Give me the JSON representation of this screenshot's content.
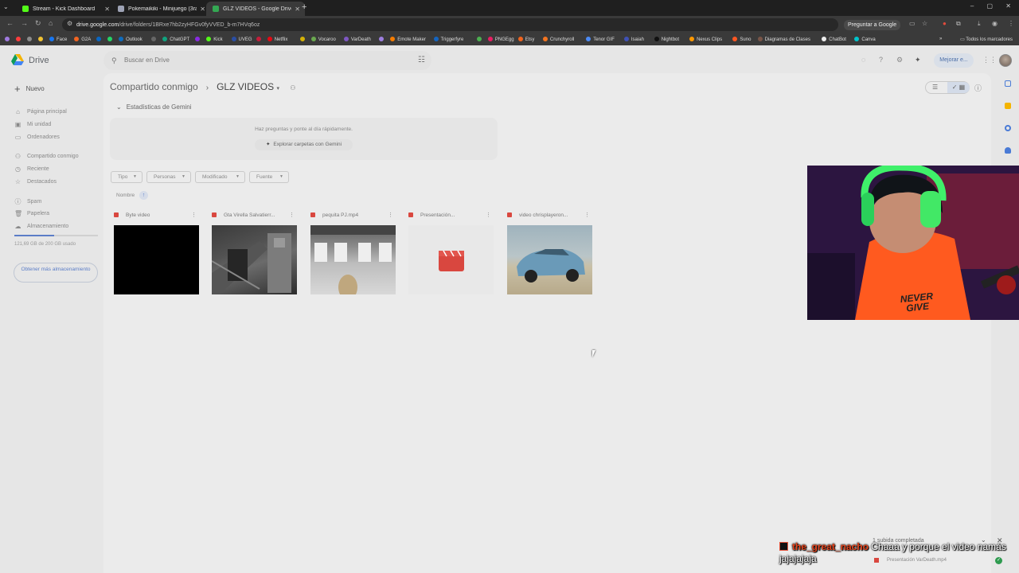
{
  "browser": {
    "tabs": [
      {
        "title": "Stream - Kick Dashboard",
        "favicon_color": "#53fc18",
        "active": false
      },
      {
        "title": "Pokemaikiki - Minijuego (3ra G",
        "favicon_color": "#9ea3b5",
        "active": false
      },
      {
        "title": "GLZ VIDEOS - Google Drive",
        "favicon_color": "#34a853",
        "active": true
      }
    ],
    "url_domain": "drive.google.com",
    "url_path": "/drive/folders/1BRxe7hb2zyHFGv0fyVVED_b-m7HVq6oz",
    "ask_google_label": "Preguntar a Google",
    "bookmarks": [
      {
        "label": "",
        "color": "#a07adf"
      },
      {
        "label": "",
        "color": "#ff3d3d"
      },
      {
        "label": "",
        "color": "#8c8c8c"
      },
      {
        "label": "",
        "color": "#f1c232"
      },
      {
        "label": "Face",
        "color": "#1877f2"
      },
      {
        "label": "G2A",
        "color": "#f26522"
      },
      {
        "label": "",
        "color": "#0a66c2"
      },
      {
        "label": "",
        "color": "#25d366"
      },
      {
        "label": "Outlook",
        "color": "#0f6cbd"
      },
      {
        "label": "",
        "color": "#666666"
      },
      {
        "label": "ChatGPT",
        "color": "#10a37f"
      },
      {
        "label": "",
        "color": "#8a2be2"
      },
      {
        "label": "Kick",
        "color": "#53fc18"
      },
      {
        "label": "UVEG",
        "color": "#2a4ea3"
      },
      {
        "label": "",
        "color": "#c41e3a"
      },
      {
        "label": "Netflix",
        "color": "#e50914"
      },
      {
        "label": "",
        "color": "#d4b106"
      },
      {
        "label": "Vocaroo",
        "color": "#6aa84f"
      },
      {
        "label": "VarDeath",
        "color": "#7e57c2"
      },
      {
        "label": "",
        "color": "#9d7fe0"
      },
      {
        "label": "Emote Maker",
        "color": "#f57c00"
      },
      {
        "label": "Triggerfyre",
        "color": "#1565c0"
      },
      {
        "label": "",
        "color": "#4caf50"
      },
      {
        "label": "PNGEgg",
        "color": "#e91e63"
      },
      {
        "label": "Etsy",
        "color": "#f1641e"
      },
      {
        "label": "Crunchyroll",
        "color": "#f47521"
      },
      {
        "label": "Tenor GIF",
        "color": "#4c8bf5"
      },
      {
        "label": "Isaiah",
        "color": "#3f51b5"
      },
      {
        "label": "Nightbot",
        "color": "#111111"
      },
      {
        "label": "Nexus Clips",
        "color": "#ff9800"
      },
      {
        "label": "Suno",
        "color": "#ff5722"
      },
      {
        "label": "Diagramas de Clases",
        "color": "#795548"
      },
      {
        "label": "ChatBot",
        "color": "#eeeeee"
      },
      {
        "label": "Canva",
        "color": "#00c4cc"
      }
    ],
    "all_bookmarks_label": "Todos los marcadores"
  },
  "drive": {
    "app_name": "Drive",
    "search_placeholder": "Buscar en Drive",
    "upgrade_label": "Mejorar e...",
    "new_label": "Nuevo",
    "sidebar": [
      {
        "label": "Página principal",
        "icon": "home-icon"
      },
      {
        "label": "Mi unidad",
        "icon": "drive-icon"
      },
      {
        "label": "Ordenadores",
        "icon": "computer-icon"
      },
      {
        "label": "Compartido conmigo",
        "icon": "people-icon"
      },
      {
        "label": "Reciente",
        "icon": "clock-icon"
      },
      {
        "label": "Destacados",
        "icon": "star-icon"
      },
      {
        "label": "Spam",
        "icon": "spam-icon"
      },
      {
        "label": "Papelera",
        "icon": "trash-icon"
      },
      {
        "label": "Almacenamiento",
        "icon": "cloud-icon"
      }
    ],
    "storage_used_fraction": 0.48,
    "storage_text": "121,69 GB de 200 GB usado",
    "get_more_storage": "Obtener más almacenamiento",
    "breadcrumb": {
      "parent": "Compartido conmigo",
      "current": "GLZ VIDEOS"
    },
    "gemini": {
      "heading": "Estadísticas de Gemini",
      "tip": "Haz preguntas y ponte al día rápidamente.",
      "button": "Explorar carpetas con Gemini"
    },
    "filters": [
      "Tipo",
      "Personas",
      "Modificado",
      "Fuente"
    ],
    "sort_label": "Nombre",
    "files": [
      {
        "name": "Byte video",
        "thumb": "black"
      },
      {
        "name": "Gta Virella Salvatierr...",
        "thumb": "street"
      },
      {
        "name": "pequita PJ.mp4",
        "thumb": "interior"
      },
      {
        "name": "Presentación...",
        "thumb": "video-placeholder"
      },
      {
        "name": "video chrisplayeron...",
        "thumb": "car"
      }
    ],
    "upload": {
      "title": "1 subida completada",
      "file": "Presentación VarDeath.mp4"
    }
  },
  "stream_overlay": {
    "chat_user": "the_great_nacho",
    "chat_message": "Chaaa y porque el video namás jajajajaja",
    "shirt_text": "NEVER GIVE"
  }
}
